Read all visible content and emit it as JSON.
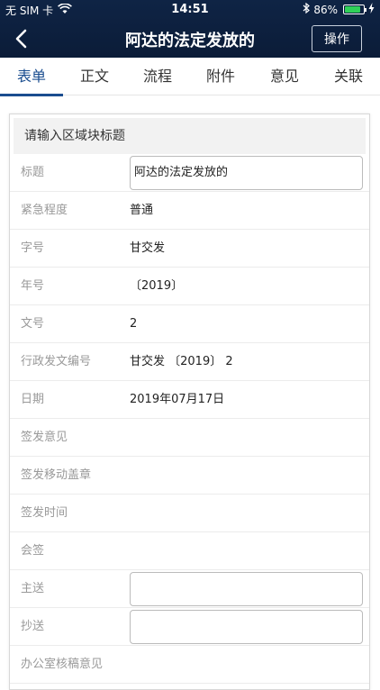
{
  "status_bar": {
    "carrier": "无 SIM 卡",
    "time": "14:51",
    "battery_text": "86%",
    "battery_level": 0.86
  },
  "navbar": {
    "title": "阿达的法定发放的",
    "action_label": "操作"
  },
  "tabs": [
    {
      "label": "表单",
      "active": true
    },
    {
      "label": "正文"
    },
    {
      "label": "流程"
    },
    {
      "label": "附件"
    },
    {
      "label": "意见"
    },
    {
      "label": "关联"
    }
  ],
  "form": {
    "section_title": "请输入区域块标题",
    "fields": [
      {
        "label": "标题",
        "value": "阿达的法定发放的",
        "kind": "input"
      },
      {
        "label": "紧急程度",
        "value": "普通",
        "kind": "text"
      },
      {
        "label": "字号",
        "value": "甘交发",
        "kind": "text"
      },
      {
        "label": "年号",
        "value": "〔2019〕",
        "kind": "text"
      },
      {
        "label": "文号",
        "value": "2",
        "kind": "text"
      },
      {
        "label": "行政发文编号",
        "value": "甘交发 〔2019〕 2",
        "kind": "text"
      },
      {
        "label": "日期",
        "value": "2019年07月17日",
        "kind": "text"
      },
      {
        "label": "签发意见",
        "value": "",
        "kind": "text"
      },
      {
        "label": "签发移动盖章",
        "value": "",
        "kind": "text"
      },
      {
        "label": "签发时间",
        "value": "",
        "kind": "text"
      },
      {
        "label": "会签",
        "value": "",
        "kind": "text"
      },
      {
        "label": "主送",
        "value": "",
        "kind": "input"
      },
      {
        "label": "抄送",
        "value": "",
        "kind": "input"
      },
      {
        "label": "办公室核稿意见",
        "value": "",
        "kind": "text"
      }
    ]
  },
  "colors": {
    "header_bg": "#0f2445",
    "active_tab": "#1a4d8f"
  }
}
